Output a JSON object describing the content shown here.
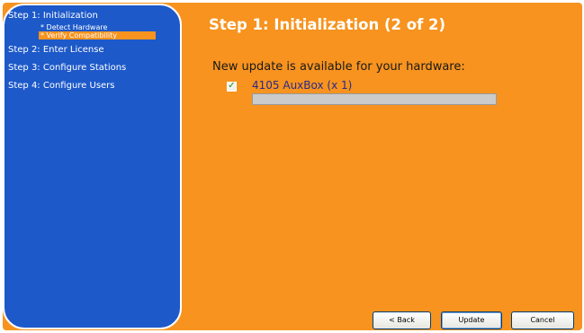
{
  "sidebar": {
    "steps": [
      {
        "label": "Step 1: Initialization"
      },
      {
        "label": "Step 2: Enter License"
      },
      {
        "label": "Step 3: Configure Stations"
      },
      {
        "label": "Step 4: Configure Users"
      }
    ],
    "substeps": [
      {
        "label": "* Detect Hardware",
        "active": false
      },
      {
        "label": "* Verify Compatibility",
        "active": true
      }
    ]
  },
  "main": {
    "title": "Step 1: Initialization (2 of 2)",
    "message": "New update is available for your hardware:",
    "hardware": {
      "label": "4105 AuxBox (x 1)",
      "checked": true,
      "progress": 0
    }
  },
  "buttons": {
    "back": "< Back",
    "update": "Update",
    "cancel": "Cancel"
  },
  "colors": {
    "panel": "#f7931e",
    "sidebar": "#1d59c9",
    "active_substep": "#f7931e"
  }
}
